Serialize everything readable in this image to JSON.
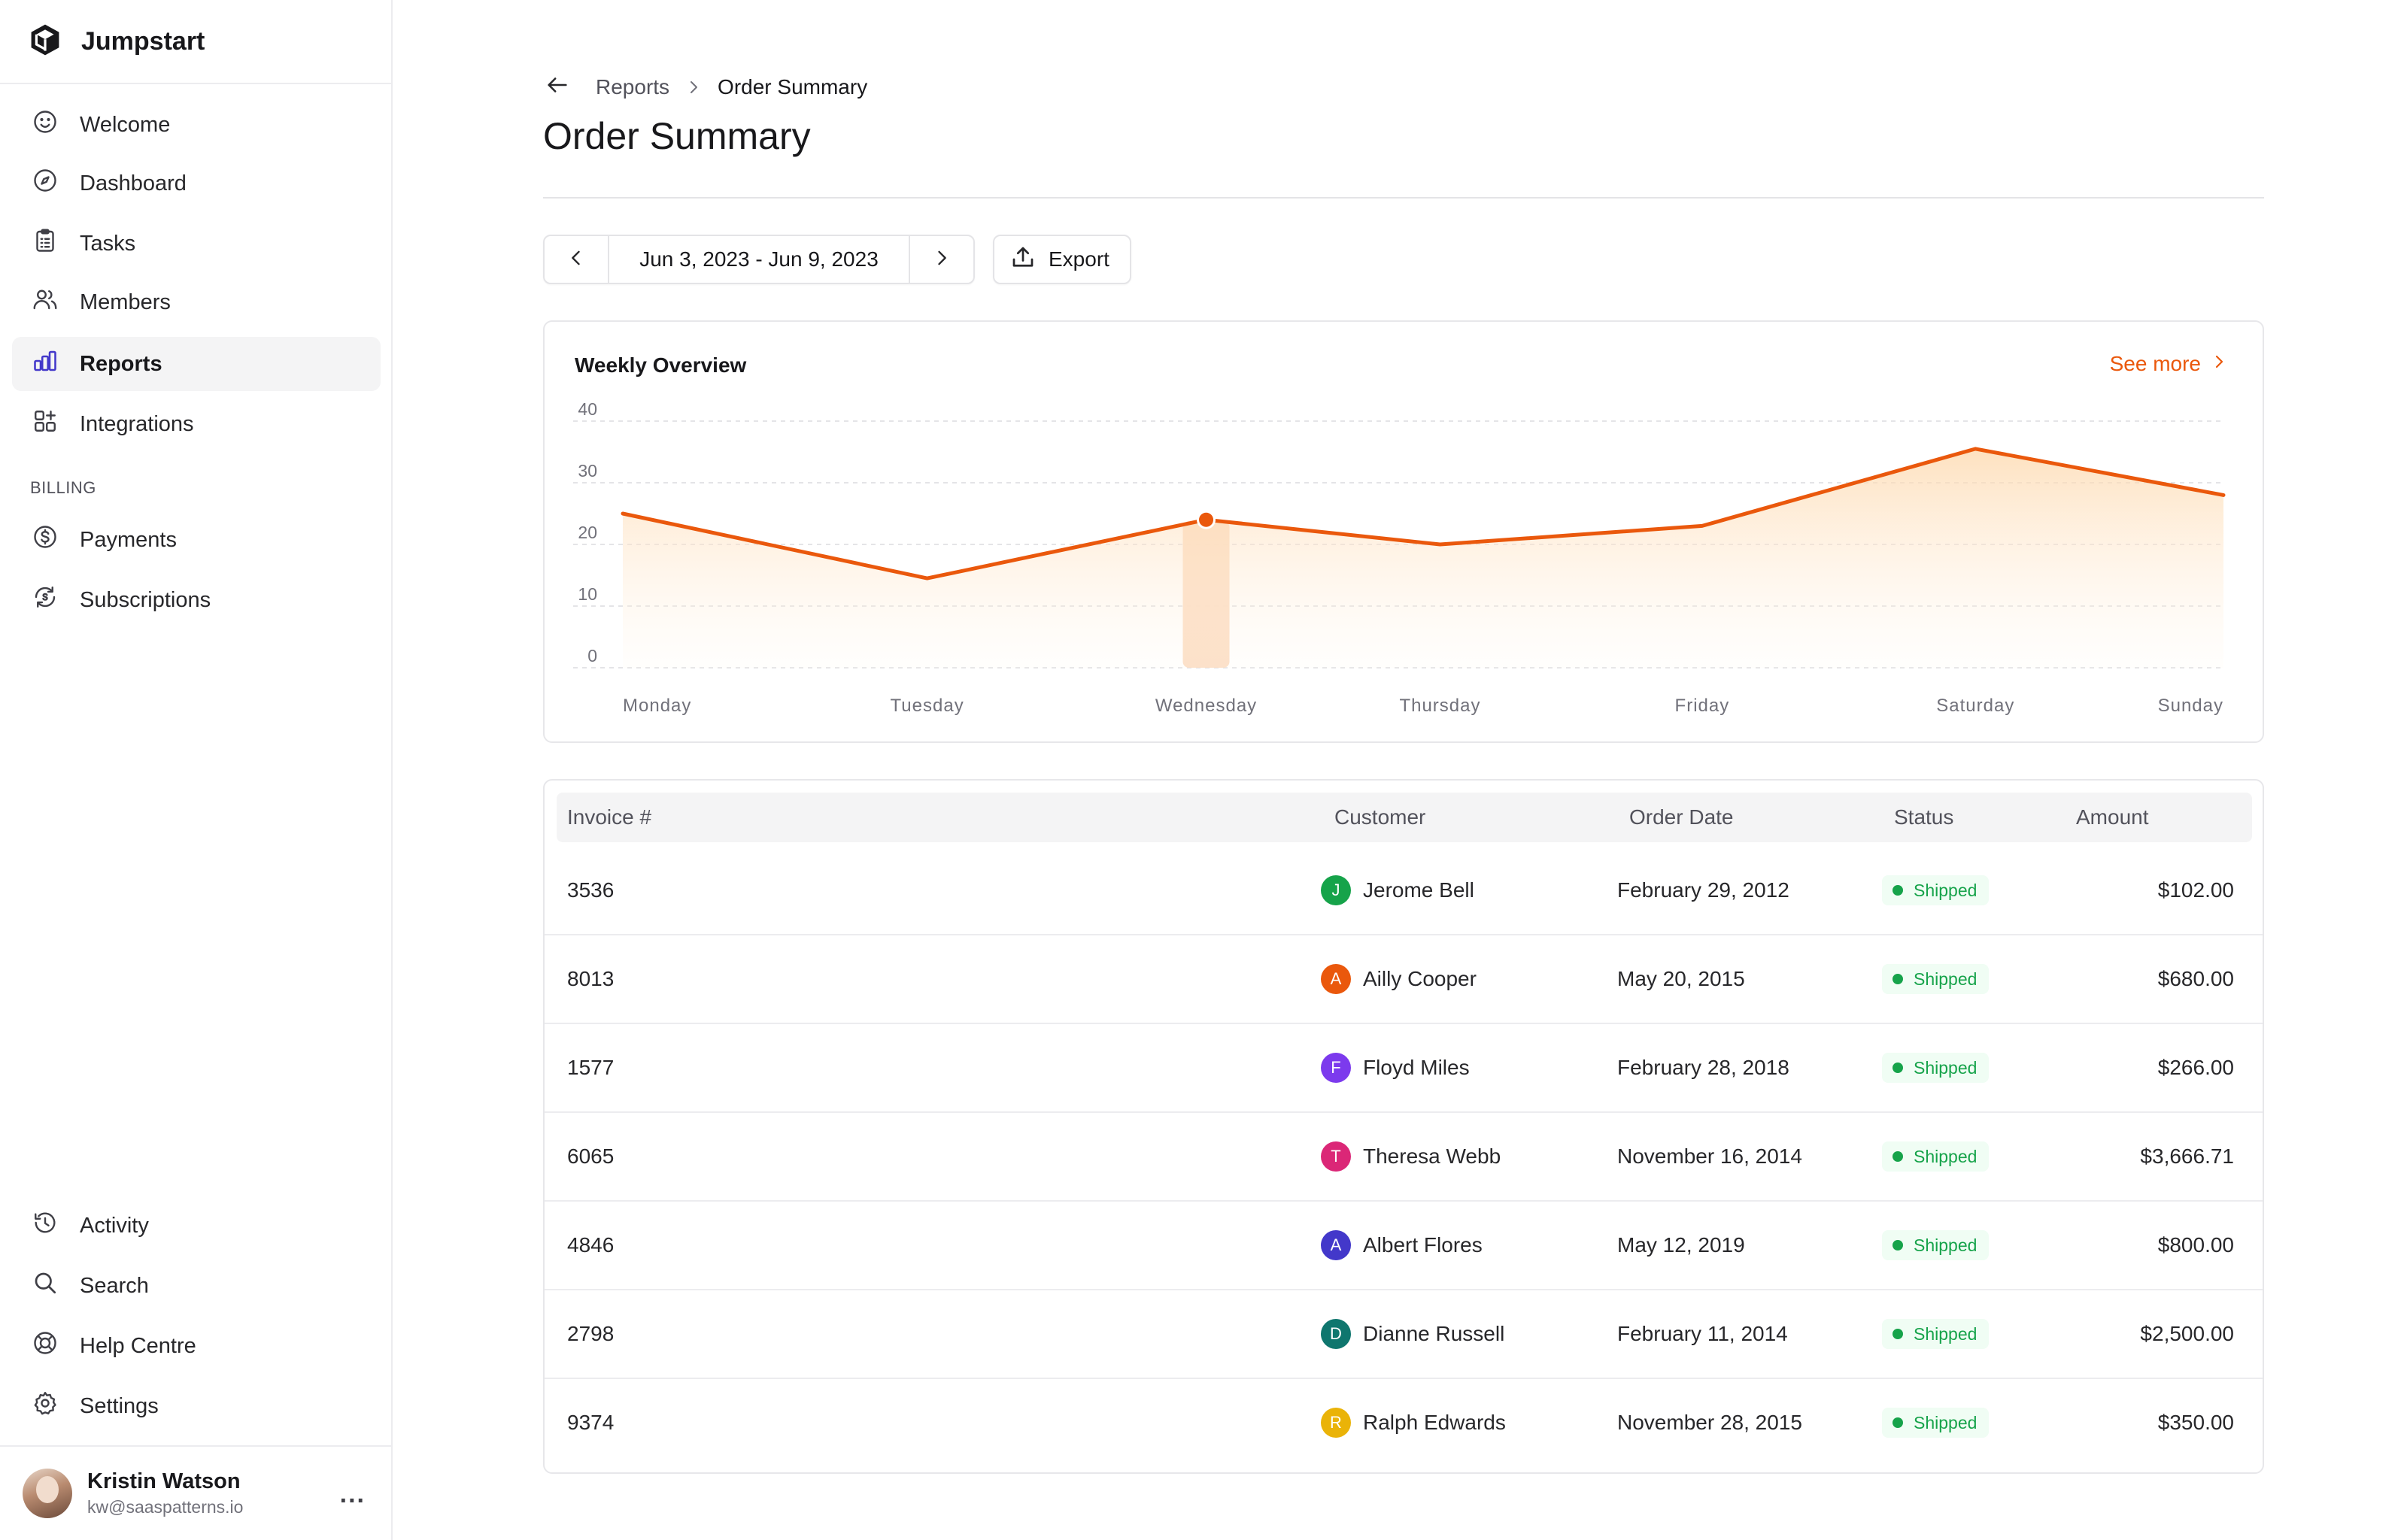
{
  "app": {
    "name": "Jumpstart",
    "logo_icon": "cube-icon"
  },
  "sidebar": {
    "items": [
      {
        "label": "Welcome",
        "icon": "smile-icon",
        "active": false
      },
      {
        "label": "Dashboard",
        "icon": "compass-icon",
        "active": false
      },
      {
        "label": "Tasks",
        "icon": "clipboard-icon",
        "active": false
      },
      {
        "label": "Members",
        "icon": "users-icon",
        "active": false
      },
      {
        "label": "Reports",
        "icon": "bar-chart-icon",
        "active": true
      },
      {
        "label": "Integrations",
        "icon": "grid-plus-icon",
        "active": false
      }
    ],
    "section_billing": "BILLING",
    "billing_items": [
      {
        "label": "Payments",
        "icon": "dollar-circle-icon"
      },
      {
        "label": "Subscriptions",
        "icon": "refresh-dollar-icon"
      }
    ],
    "bottom_items": [
      {
        "label": "Activity",
        "icon": "history-icon"
      },
      {
        "label": "Search",
        "icon": "search-icon"
      },
      {
        "label": "Help Centre",
        "icon": "lifebuoy-icon"
      },
      {
        "label": "Settings",
        "icon": "gear-icon"
      }
    ],
    "user": {
      "name": "Kristin Watson",
      "email": "kw@saaspatterns.io",
      "menu": "..."
    }
  },
  "breadcrumb": {
    "parent": "Reports",
    "current": "Order Summary"
  },
  "page": {
    "title": "Order Summary"
  },
  "toolbar": {
    "date_range": "Jun 3, 2023 - Jun 9, 2023",
    "export_label": "Export"
  },
  "chart_card": {
    "title": "Weekly Overview",
    "see_more": "See more"
  },
  "chart_data": {
    "type": "area",
    "title": "Weekly Overview",
    "categories": [
      "Monday",
      "Tuesday",
      "Wednesday",
      "Thursday",
      "Friday",
      "Saturday",
      "Sunday"
    ],
    "x_points": [
      0,
      1.08,
      2.07,
      2.9,
      3.83,
      4.8,
      5.68
    ],
    "values": [
      25,
      14.5,
      24,
      20,
      23,
      35.5,
      28
    ],
    "ylim": [
      0,
      40
    ],
    "yticks": [
      0,
      10,
      20,
      30,
      40
    ],
    "highlight": {
      "category": "Wednesday",
      "value": 24
    },
    "grid": true,
    "color": "#ea580c"
  },
  "table": {
    "columns": [
      "Invoice #",
      "Customer",
      "Order Date",
      "Status",
      "Amount"
    ],
    "rows": [
      {
        "invoice": "3536",
        "initial": "J",
        "customer": "Jerome Bell",
        "date": "February 29, 2012",
        "status": "Shipped",
        "amount": "$102.00",
        "color": "#16a34a"
      },
      {
        "invoice": "8013",
        "initial": "A",
        "customer": "Ailly Cooper",
        "date": "May 20, 2015",
        "status": "Shipped",
        "amount": "$680.00",
        "color": "#ea580c"
      },
      {
        "invoice": "1577",
        "initial": "F",
        "customer": "Floyd Miles",
        "date": "February 28, 2018",
        "status": "Shipped",
        "amount": "$266.00",
        "color": "#7c3aed"
      },
      {
        "invoice": "6065",
        "initial": "T",
        "customer": "Theresa Webb",
        "date": "November 16, 2014",
        "status": "Shipped",
        "amount": "$3,666.71",
        "color": "#db2777"
      },
      {
        "invoice": "4846",
        "initial": "A",
        "customer": "Albert Flores",
        "date": "May 12, 2019",
        "status": "Shipped",
        "amount": "$800.00",
        "color": "#4338ca"
      },
      {
        "invoice": "2798",
        "initial": "D",
        "customer": "Dianne Russell",
        "date": "February 11, 2014",
        "status": "Shipped",
        "amount": "$2,500.00",
        "color": "#0f766e"
      },
      {
        "invoice": "9374",
        "initial": "R",
        "customer": "Ralph Edwards",
        "date": "November 28, 2015",
        "status": "Shipped",
        "amount": "$350.00",
        "color": "#eab308"
      }
    ]
  }
}
